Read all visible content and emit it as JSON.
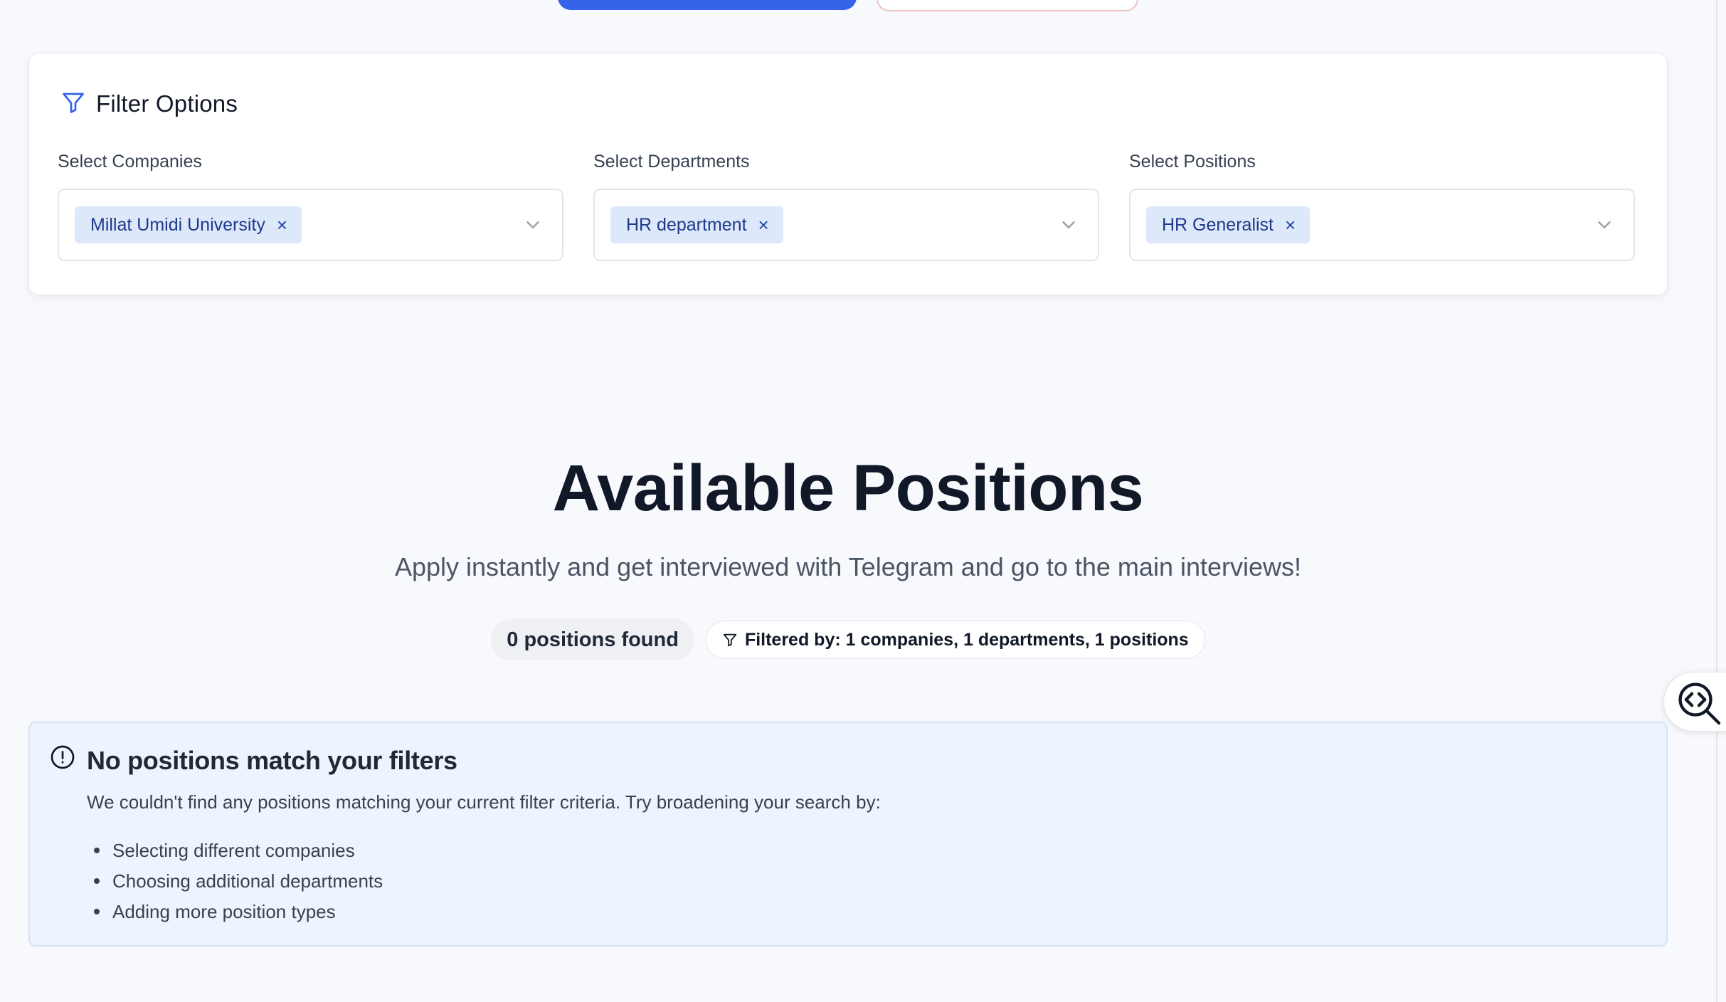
{
  "top_actions": {
    "primary_button": "",
    "secondary_button": ""
  },
  "filter": {
    "title": "Filter Options",
    "companies": {
      "label": "Select Companies",
      "selected": "Millat Umidi University"
    },
    "departments": {
      "label": "Select Departments",
      "selected": "HR department"
    },
    "positions": {
      "label": "Select Positions",
      "selected": "HR Generalist"
    },
    "chip_remove": "×"
  },
  "main": {
    "heading": "Available Positions",
    "subtitle": "Apply instantly and get interviewed with Telegram and go to the main interviews!",
    "count_badge": "0 positions found",
    "filter_summary": "Filtered by: 1 companies, 1 departments, 1 positions"
  },
  "alert": {
    "title": "No positions match your filters",
    "description": "We couldn't find any positions matching your current filter criteria. Try broadening your search by:",
    "suggestions": [
      "Selecting different companies",
      "Choosing additional departments",
      "Adding more position types"
    ]
  },
  "icons": {
    "filter": "filter-icon",
    "chevron": "chevron-down-icon",
    "alert": "alert-circle-icon",
    "inspector": "code-search-icon"
  },
  "colors": {
    "accent": "#3563e9",
    "chip_bg": "#dde8fb",
    "chip_text": "#1f3a8a",
    "alert_bg": "#eef4fd"
  }
}
